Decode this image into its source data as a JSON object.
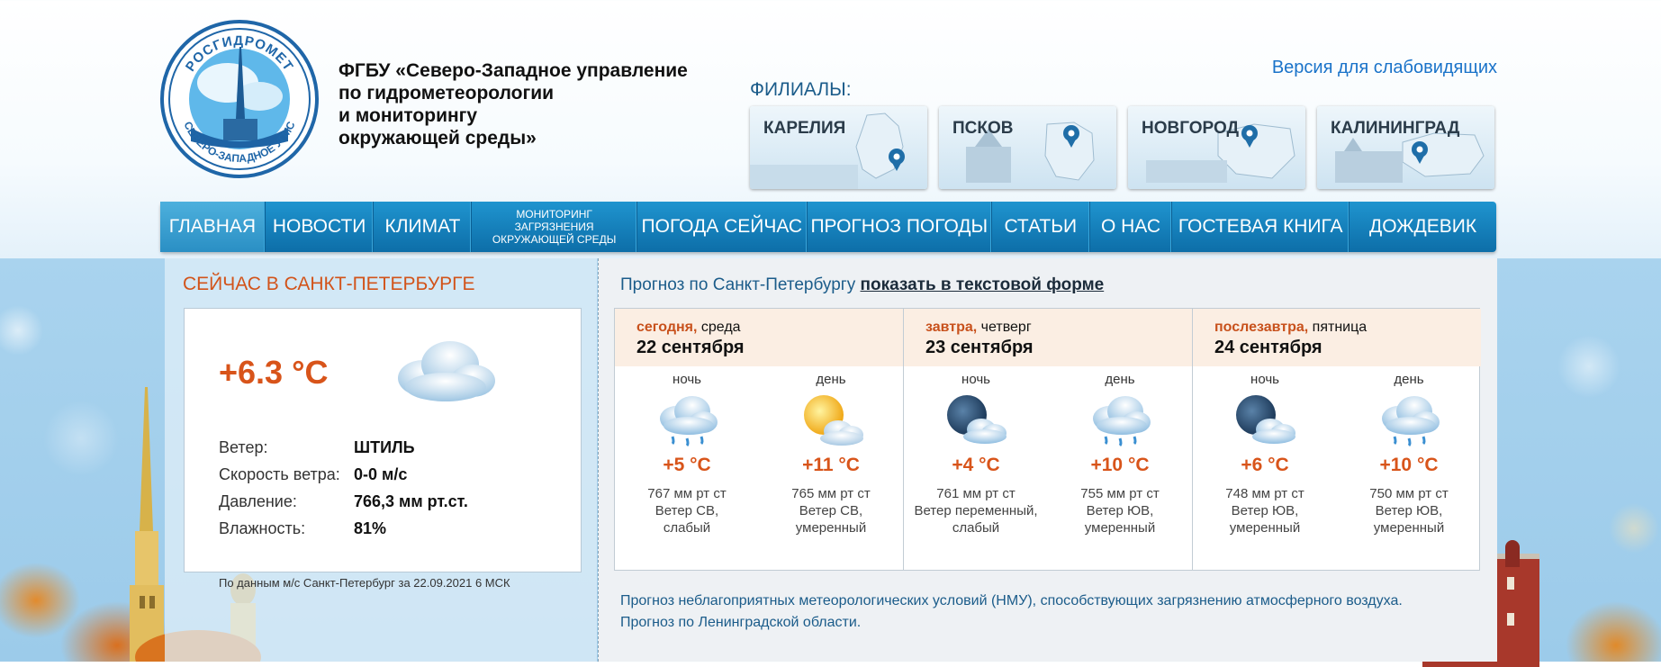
{
  "header": {
    "logo_text_top": "РОСГИДРОМЕТ",
    "logo_text_bottom": "СЕВЕРО-ЗАПАДНОЕ УГМС",
    "org_name": "ФГБУ «Северо-Западное управление\nпо гидрометеорологии\nи мониторингу\nокружающей среды»",
    "accessibility_link": "Версия для слабовидящих",
    "branches_label": "ФИЛИАЛЫ:",
    "branches": [
      {
        "name": "КАРЕЛИЯ"
      },
      {
        "name": "ПСКОВ"
      },
      {
        "name": "НОВГОРОД"
      },
      {
        "name": "КАЛИНИНГРАД"
      }
    ]
  },
  "nav": {
    "items": [
      {
        "label": "ГЛАВНАЯ"
      },
      {
        "label": "НОВОСТИ"
      },
      {
        "label": "КЛИМАТ"
      },
      {
        "label": "МОНИТОРИНГ ЗАГРЯЗНЕНИЯ ОКРУЖАЮЩЕЙ СРЕДЫ"
      },
      {
        "label": "ПОГОДА СЕЙЧАС"
      },
      {
        "label": "ПРОГНОЗ ПОГОДЫ"
      },
      {
        "label": "СТАТЬИ"
      },
      {
        "label": "О НАС"
      },
      {
        "label": "ГОСТЕВАЯ КНИГА"
      },
      {
        "label": "ДОЖДЕВИК"
      }
    ]
  },
  "now": {
    "title": "СЕЙЧАС В САНКТ-ПЕТЕРБУРГЕ",
    "temperature": "+6.3 °С",
    "icon": "cloud-icon",
    "params": [
      {
        "label": "Ветер:",
        "value": "ШТИЛЬ"
      },
      {
        "label": "Скорость ветра:",
        "value": "0-0 м/с"
      },
      {
        "label": "Давление:",
        "value": "766,3 мм рт.ст."
      },
      {
        "label": "Влажность:",
        "value": "81%"
      }
    ],
    "source": "По данным м/с Санкт-Петербург за 22.09.2021 6 МСК"
  },
  "forecast": {
    "header_text": "Прогноз по Санкт-Петербургу",
    "header_link": "показать в текстовой форме",
    "days": [
      {
        "rel": "сегодня,",
        "weekday": "среда",
        "date": "22 сентября",
        "periods": [
          {
            "tod": "ночь",
            "icon": "cloud-rain-icon",
            "temp": "+5 °С",
            "info": "767 мм рт ст\nВетер СВ,\nслабый"
          },
          {
            "tod": "день",
            "icon": "sun-cloud-icon",
            "temp": "+11 °С",
            "info": "765 мм рт ст\nВетер СВ,\nумеренный"
          }
        ]
      },
      {
        "rel": "завтра,",
        "weekday": "четверг",
        "date": "23 сентября",
        "periods": [
          {
            "tod": "ночь",
            "icon": "moon-cloud-icon",
            "temp": "+4 °С",
            "info": "761 мм рт ст\nВетер переменный,\nслабый"
          },
          {
            "tod": "день",
            "icon": "cloud-rain-icon",
            "temp": "+10 °С",
            "info": "755 мм рт ст\nВетер ЮВ,\nумеренный"
          }
        ]
      },
      {
        "rel": "послезавтра,",
        "weekday": "пятница",
        "date": "24 сентября",
        "periods": [
          {
            "tod": "ночь",
            "icon": "moon-cloud-icon",
            "temp": "+6 °С",
            "info": "748 мм рт ст\nВетер ЮВ,\nумеренный"
          },
          {
            "tod": "день",
            "icon": "cloud-rain-icon",
            "temp": "+10 °С",
            "info": "750 мм рт ст\nВетер ЮВ,\nумеренный"
          }
        ]
      }
    ],
    "links": [
      "Прогноз неблагоприятных метеорологических условий (НМУ), способствующих загрязнению атмосферного воздуха.",
      "Прогноз по Ленинградской области."
    ]
  },
  "colors": {
    "accent_orange": "#d8541a",
    "nav_blue": "#1f94cf",
    "link_blue": "#1a73c9"
  }
}
